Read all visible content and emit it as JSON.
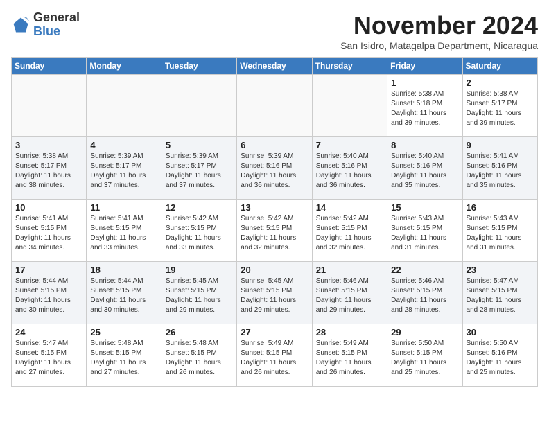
{
  "logo": {
    "general": "General",
    "blue": "Blue"
  },
  "header": {
    "month": "November 2024",
    "location": "San Isidro, Matagalpa Department, Nicaragua"
  },
  "weekdays": [
    "Sunday",
    "Monday",
    "Tuesday",
    "Wednesday",
    "Thursday",
    "Friday",
    "Saturday"
  ],
  "weeks": [
    [
      {
        "day": "",
        "info": ""
      },
      {
        "day": "",
        "info": ""
      },
      {
        "day": "",
        "info": ""
      },
      {
        "day": "",
        "info": ""
      },
      {
        "day": "",
        "info": ""
      },
      {
        "day": "1",
        "info": "Sunrise: 5:38 AM\nSunset: 5:18 PM\nDaylight: 11 hours\nand 39 minutes."
      },
      {
        "day": "2",
        "info": "Sunrise: 5:38 AM\nSunset: 5:17 PM\nDaylight: 11 hours\nand 39 minutes."
      }
    ],
    [
      {
        "day": "3",
        "info": "Sunrise: 5:38 AM\nSunset: 5:17 PM\nDaylight: 11 hours\nand 38 minutes."
      },
      {
        "day": "4",
        "info": "Sunrise: 5:39 AM\nSunset: 5:17 PM\nDaylight: 11 hours\nand 37 minutes."
      },
      {
        "day": "5",
        "info": "Sunrise: 5:39 AM\nSunset: 5:17 PM\nDaylight: 11 hours\nand 37 minutes."
      },
      {
        "day": "6",
        "info": "Sunrise: 5:39 AM\nSunset: 5:16 PM\nDaylight: 11 hours\nand 36 minutes."
      },
      {
        "day": "7",
        "info": "Sunrise: 5:40 AM\nSunset: 5:16 PM\nDaylight: 11 hours\nand 36 minutes."
      },
      {
        "day": "8",
        "info": "Sunrise: 5:40 AM\nSunset: 5:16 PM\nDaylight: 11 hours\nand 35 minutes."
      },
      {
        "day": "9",
        "info": "Sunrise: 5:41 AM\nSunset: 5:16 PM\nDaylight: 11 hours\nand 35 minutes."
      }
    ],
    [
      {
        "day": "10",
        "info": "Sunrise: 5:41 AM\nSunset: 5:15 PM\nDaylight: 11 hours\nand 34 minutes."
      },
      {
        "day": "11",
        "info": "Sunrise: 5:41 AM\nSunset: 5:15 PM\nDaylight: 11 hours\nand 33 minutes."
      },
      {
        "day": "12",
        "info": "Sunrise: 5:42 AM\nSunset: 5:15 PM\nDaylight: 11 hours\nand 33 minutes."
      },
      {
        "day": "13",
        "info": "Sunrise: 5:42 AM\nSunset: 5:15 PM\nDaylight: 11 hours\nand 32 minutes."
      },
      {
        "day": "14",
        "info": "Sunrise: 5:42 AM\nSunset: 5:15 PM\nDaylight: 11 hours\nand 32 minutes."
      },
      {
        "day": "15",
        "info": "Sunrise: 5:43 AM\nSunset: 5:15 PM\nDaylight: 11 hours\nand 31 minutes."
      },
      {
        "day": "16",
        "info": "Sunrise: 5:43 AM\nSunset: 5:15 PM\nDaylight: 11 hours\nand 31 minutes."
      }
    ],
    [
      {
        "day": "17",
        "info": "Sunrise: 5:44 AM\nSunset: 5:15 PM\nDaylight: 11 hours\nand 30 minutes."
      },
      {
        "day": "18",
        "info": "Sunrise: 5:44 AM\nSunset: 5:15 PM\nDaylight: 11 hours\nand 30 minutes."
      },
      {
        "day": "19",
        "info": "Sunrise: 5:45 AM\nSunset: 5:15 PM\nDaylight: 11 hours\nand 29 minutes."
      },
      {
        "day": "20",
        "info": "Sunrise: 5:45 AM\nSunset: 5:15 PM\nDaylight: 11 hours\nand 29 minutes."
      },
      {
        "day": "21",
        "info": "Sunrise: 5:46 AM\nSunset: 5:15 PM\nDaylight: 11 hours\nand 29 minutes."
      },
      {
        "day": "22",
        "info": "Sunrise: 5:46 AM\nSunset: 5:15 PM\nDaylight: 11 hours\nand 28 minutes."
      },
      {
        "day": "23",
        "info": "Sunrise: 5:47 AM\nSunset: 5:15 PM\nDaylight: 11 hours\nand 28 minutes."
      }
    ],
    [
      {
        "day": "24",
        "info": "Sunrise: 5:47 AM\nSunset: 5:15 PM\nDaylight: 11 hours\nand 27 minutes."
      },
      {
        "day": "25",
        "info": "Sunrise: 5:48 AM\nSunset: 5:15 PM\nDaylight: 11 hours\nand 27 minutes."
      },
      {
        "day": "26",
        "info": "Sunrise: 5:48 AM\nSunset: 5:15 PM\nDaylight: 11 hours\nand 26 minutes."
      },
      {
        "day": "27",
        "info": "Sunrise: 5:49 AM\nSunset: 5:15 PM\nDaylight: 11 hours\nand 26 minutes."
      },
      {
        "day": "28",
        "info": "Sunrise: 5:49 AM\nSunset: 5:15 PM\nDaylight: 11 hours\nand 26 minutes."
      },
      {
        "day": "29",
        "info": "Sunrise: 5:50 AM\nSunset: 5:15 PM\nDaylight: 11 hours\nand 25 minutes."
      },
      {
        "day": "30",
        "info": "Sunrise: 5:50 AM\nSunset: 5:16 PM\nDaylight: 11 hours\nand 25 minutes."
      }
    ]
  ]
}
